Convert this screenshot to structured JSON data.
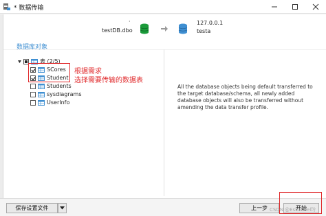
{
  "window": {
    "title": "* 数据传输",
    "controls": [
      "minimize-icon",
      "maximize-icon",
      "close-icon"
    ]
  },
  "header": {
    "source_dot": "·",
    "source_name": "testDB.dbo",
    "target_host": "127.0.0.1",
    "target_db": "testa",
    "source_color": "#1b9b3a",
    "target_color": "#3f8fd2"
  },
  "section_title": "数据库对象",
  "tree": {
    "root_label": "表 (2/5)",
    "items": [
      {
        "label": "SCores",
        "checked": true
      },
      {
        "label": "Student",
        "checked": true
      },
      {
        "label": "Students",
        "checked": false
      },
      {
        "label": "sysdiagrams",
        "checked": false
      },
      {
        "label": "UserInfo",
        "checked": false
      }
    ]
  },
  "annotation": {
    "line1": "根据需求",
    "line2": "选择需要传输的数据表",
    "color": "#e0292b"
  },
  "description": "All the database objects being default transferred to the target database/schema, all newly added database objects will also be transferred without amending the data transfer profile.",
  "buttons": {
    "save_profile": "保存设置文件",
    "prev": "上一步",
    "start": "开始"
  },
  "watermark": "CSDN @Eskaticel玲"
}
